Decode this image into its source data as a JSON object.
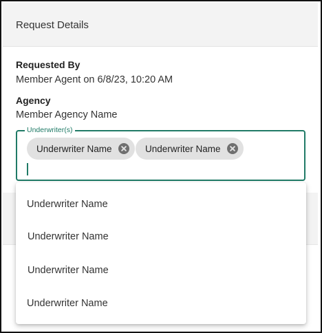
{
  "header": {
    "title": "Request Details"
  },
  "requested_by": {
    "label": "Requested By",
    "value": "Member Agent on 6/8/23, 10:20 AM"
  },
  "agency": {
    "label": "Agency",
    "value": "Member Agency Name"
  },
  "underwriters": {
    "label": "Underwriter(s)",
    "input_value": "",
    "chips": [
      {
        "label": "Underwriter Name",
        "remove_icon": "close-circle-icon"
      },
      {
        "label": "Underwriter Name",
        "remove_icon": "close-circle-icon"
      }
    ],
    "accent_color": "#1f7a66"
  },
  "dropdown": {
    "options": [
      {
        "label": "Underwriter Name"
      },
      {
        "label": "Underwriter Name"
      },
      {
        "label": "Underwriter Name"
      },
      {
        "label": "Underwriter Name"
      }
    ]
  }
}
